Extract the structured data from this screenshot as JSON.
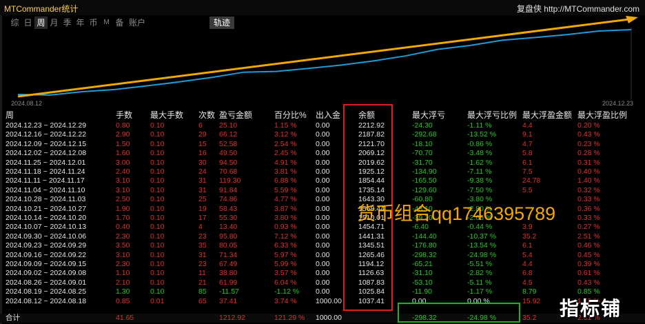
{
  "app": {
    "title": "MTCommander统计",
    "brand": "复盘侠 http://MTCommander.com"
  },
  "tabs": [
    {
      "label": "综",
      "active": false
    },
    {
      "label": "日",
      "active": false
    },
    {
      "label": "周",
      "active": true
    },
    {
      "label": "月",
      "active": false
    },
    {
      "label": "季",
      "active": false
    },
    {
      "label": "年",
      "active": false
    },
    {
      "label": "币",
      "active": false
    },
    {
      "label": "M",
      "active": false
    },
    {
      "label": "备",
      "active": false
    },
    {
      "label": "账户",
      "active": false
    }
  ],
  "trail_tab": "轨迹",
  "chart": {
    "start_date": "2024.08.12",
    "end_date": "2024.12.23",
    "line_color": "#1e9bd8",
    "arrow_color": "#f2a800"
  },
  "columns": [
    "周",
    "手数",
    "最大手数",
    "次数",
    "盈亏金额",
    "百分比%",
    "出入金",
    "余额",
    "最大浮亏",
    "最大浮亏比例",
    "最大浮盈金额",
    "最大浮盈比例"
  ],
  "rows": [
    [
      "2024.12.23 ~ 2024.12.29",
      "0.80",
      "0.10",
      "6",
      "25.10",
      "1.15 %",
      "0.00",
      "2212.92",
      "-24.30",
      "-1.11 %",
      "4.4",
      "0.20 %"
    ],
    [
      "2024.12.16 ~ 2024.12.22",
      "2.90",
      "0.10",
      "29",
      "66.12",
      "3.12 %",
      "0.00",
      "2187.82",
      "-292.68",
      "-13.52 %",
      "9.1",
      "0.43 %"
    ],
    [
      "2024.12.09 ~ 2024.12.15",
      "1.50",
      "0.10",
      "15",
      "52.58",
      "2.54 %",
      "0.00",
      "2121.70",
      "-18.10",
      "-0.86 %",
      "4.7",
      "0.23 %"
    ],
    [
      "2024.12.02 ~ 2024.12.08",
      "1.60",
      "0.10",
      "16",
      "49.50",
      "2.45 %",
      "0.00",
      "2069.12",
      "-70.70",
      "-3.48 %",
      "5.8",
      "0.28 %"
    ],
    [
      "2024.11.25 ~ 2024.12.01",
      "3.00",
      "0.10",
      "30",
      "94.50",
      "4.91 %",
      "0.00",
      "2019.62",
      "-31.70",
      "-1.62 %",
      "6.1",
      "0.31 %"
    ],
    [
      "2024.11.18 ~ 2024.11.24",
      "2.40",
      "0.10",
      "24",
      "70.68",
      "3.81 %",
      "0.00",
      "1925.12",
      "-134.90",
      "-7.11 %",
      "7.5",
      "0.40 %"
    ],
    [
      "2024.11.11 ~ 2024.11.17",
      "3.10",
      "0.10",
      "31",
      "119.30",
      "6.88 %",
      "0.00",
      "1854.44",
      "-165.50",
      "-9.38 %",
      "24.78",
      "1.40 %"
    ],
    [
      "2024.11.04 ~ 2024.11.10",
      "3.10",
      "0.10",
      "31",
      "91.84",
      "5.59 %",
      "0.00",
      "1735.14",
      "-129.60",
      "-7.50 %",
      "5.5",
      "0.32 %"
    ],
    [
      "2024.10.28 ~ 2024.11.03",
      "2.50",
      "0.10",
      "25",
      "74.86",
      "4.77 %",
      "0.00",
      "1643.30",
      "-60.80",
      "-3.80 %",
      "",
      "0.33 %"
    ],
    [
      "2024.10.21 ~ 2024.10.27",
      "1.90",
      "0.10",
      "19",
      "58.43",
      "3.87 %",
      "0.00",
      "1568.44",
      "-43.10",
      "-2.80 %",
      "",
      "0.36 %"
    ],
    [
      "2024.10.14 ~ 2024.10.20",
      "1.70",
      "0.10",
      "17",
      "55.30",
      "3.80 %",
      "0.00",
      "1510.01",
      "-39.20",
      "-2.65 %",
      "",
      "0.33 %"
    ],
    [
      "2024.10.07 ~ 2024.10.13",
      "0.40",
      "0.10",
      "4",
      "13.40",
      "0.93 %",
      "0.00",
      "1454.71",
      "-6.40",
      "-0.44 %",
      "3.9",
      "0.27 %"
    ],
    [
      "2024.09.30 ~ 2024.10.06",
      "2.30",
      "0.10",
      "23",
      "95.80",
      "7.12 %",
      "0.00",
      "1441.31",
      "-144.40",
      "-10.37 %",
      "35.2",
      "2.51 %"
    ],
    [
      "2024.09.23 ~ 2024.09.29",
      "3.50",
      "0.10",
      "35",
      "80.05",
      "6.33 %",
      "0.00",
      "1345.51",
      "-176.80",
      "-13.54 %",
      "6.1",
      "0.46 %"
    ],
    [
      "2024.09.16 ~ 2024.09.22",
      "3.10",
      "0.10",
      "31",
      "71.34",
      "5.97 %",
      "0.00",
      "1265.46",
      "-298.32",
      "-24.98 %",
      "5.4",
      "0.45 %"
    ],
    [
      "2024.09.09 ~ 2024.09.15",
      "2.30",
      "0.10",
      "23",
      "67.49",
      "5.99 %",
      "0.00",
      "1194.12",
      "-65.21",
      "-5.51 %",
      "4.4",
      "0.39 %"
    ],
    [
      "2024.09.02 ~ 2024.09.08",
      "1.10",
      "0.10",
      "11",
      "38.80",
      "3.57 %",
      "0.00",
      "1126.63",
      "-31.10",
      "-2.82 %",
      "6.8",
      "0.61 %"
    ],
    [
      "2024.08.26 ~ 2024.09.01",
      "2.10",
      "0.10",
      "21",
      "61.99",
      "6.04 %",
      "0.00",
      "1087.83",
      "-53.10",
      "-5.11 %",
      "4.5",
      "0.43 %"
    ],
    [
      "2024.08.19 ~ 2024.08.25",
      "1.30",
      "0.10",
      "85",
      "-11.57",
      "-1.12 %",
      "0.00",
      "1025.84",
      "-11.90",
      "-1.17 %",
      "8.79",
      "0.85 %"
    ],
    [
      "2024.08.12 ~ 2024.08.18",
      "0.85",
      "0.01",
      "65",
      "37.41",
      "3.74 %",
      "1000.00",
      "1037.41",
      "0.00",
      "0.00 %",
      "15.92",
      "1.59 %"
    ]
  ],
  "total": [
    "合计",
    "41.65",
    "",
    "",
    "1212.92",
    "121.29 %",
    "1000.00",
    "",
    "-298.32",
    "-24.98 %",
    "35.2",
    "2.51 %"
  ],
  "watermark": "货币组合qq1746395789",
  "watermark_logo": "指标铺",
  "colors": {
    "profit": "#e03030",
    "loss": "#28c828",
    "highlight_red": "#e02020",
    "highlight_green": "#20b020"
  }
}
